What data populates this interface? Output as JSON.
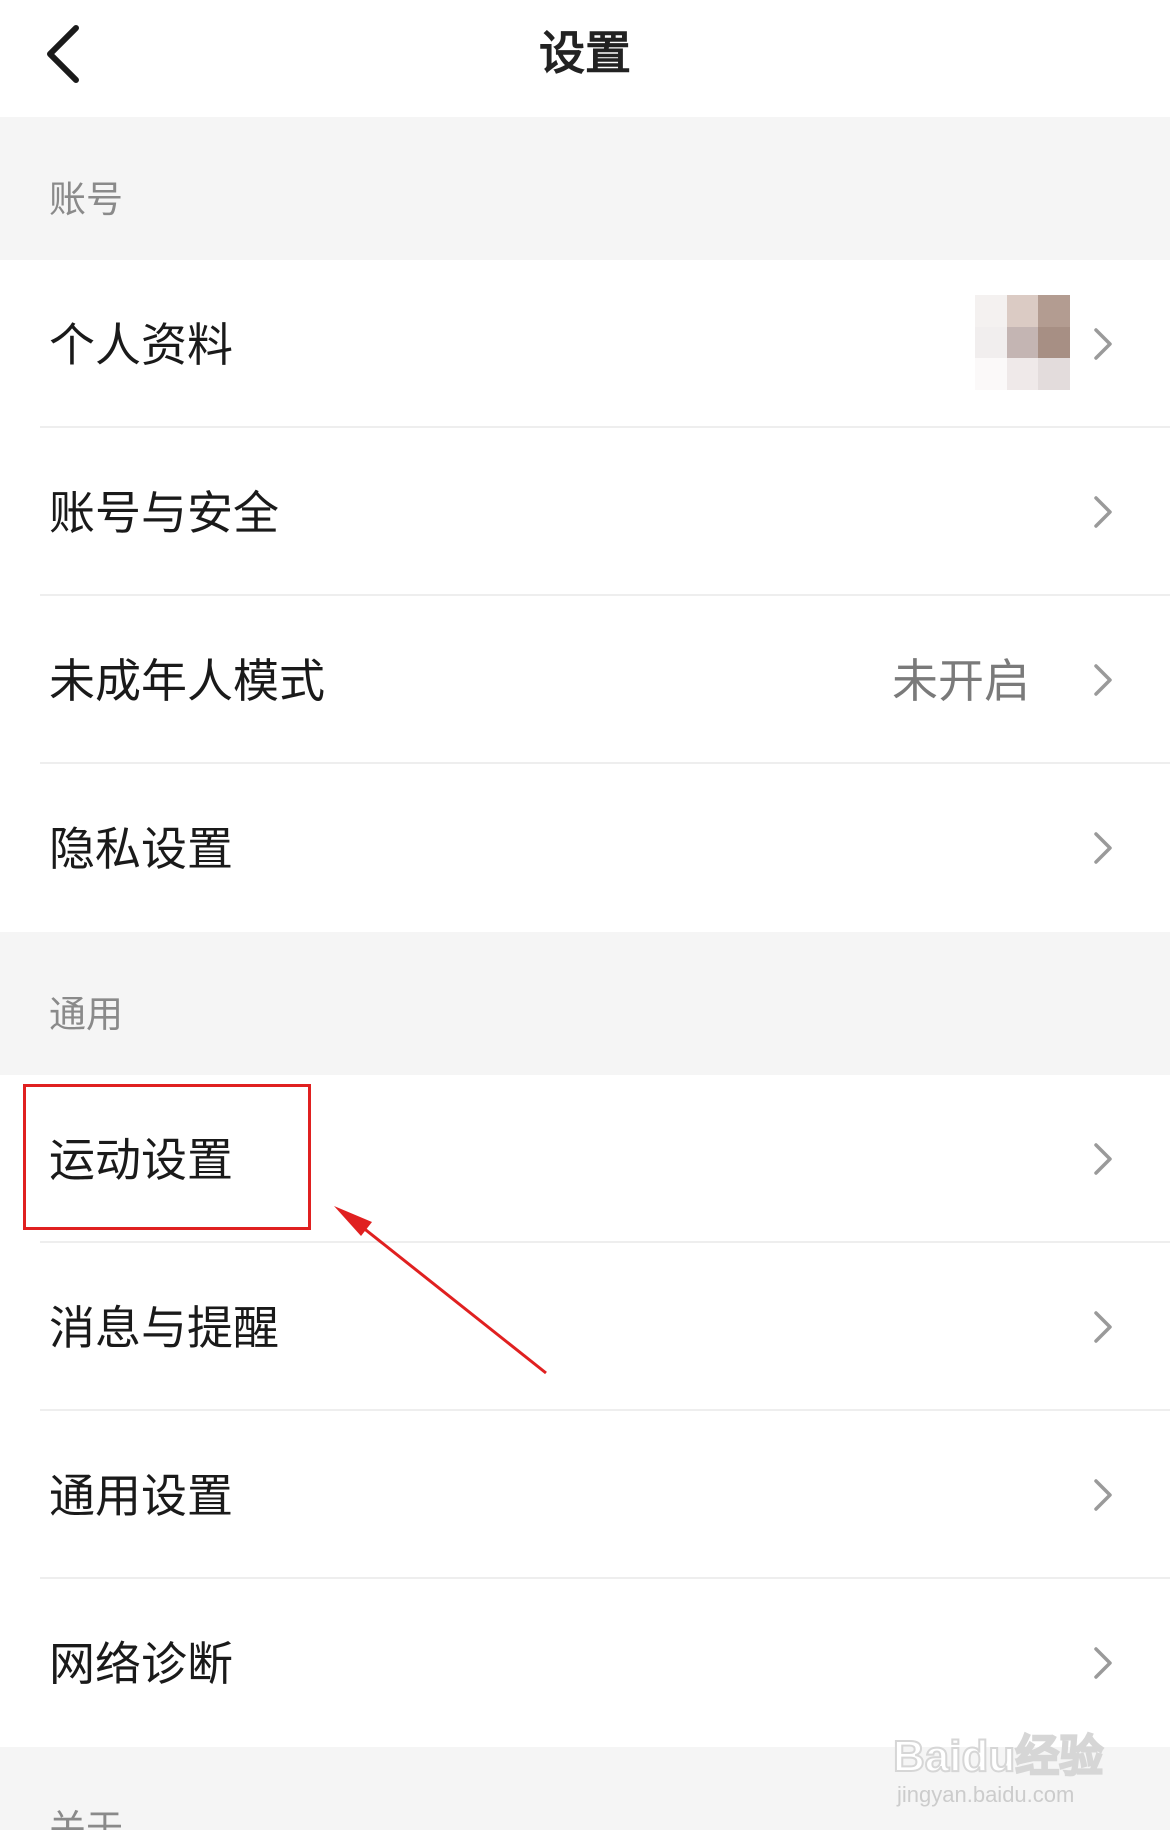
{
  "header": {
    "title": "设置",
    "back_icon": "chevron-left-icon"
  },
  "sections": [
    {
      "title": "账号",
      "items": [
        {
          "label": "个人资料",
          "value": "",
          "has_avatar": true
        },
        {
          "label": "账号与安全",
          "value": ""
        },
        {
          "label": "未成年人模式",
          "value": "未开启"
        },
        {
          "label": "隐私设置",
          "value": ""
        }
      ]
    },
    {
      "title": "通用",
      "items": [
        {
          "label": "运动设置",
          "value": "",
          "highlighted": true
        },
        {
          "label": "消息与提醒",
          "value": ""
        },
        {
          "label": "通用设置",
          "value": ""
        },
        {
          "label": "网络诊断",
          "value": ""
        }
      ]
    },
    {
      "title": "关于",
      "items": []
    }
  ],
  "annotation": {
    "box_color": "#e02020",
    "arrow_color": "#e02020"
  },
  "watermark": {
    "brand": "Baidu经验",
    "url": "jingyan.baidu.com"
  },
  "colors": {
    "section_bg": "#f5f5f5",
    "row_bg": "#ffffff",
    "section_title": "#8a8a8a",
    "label_text": "#1a1a1a",
    "value_text": "#7a7a7a",
    "chevron": "#9a9a9a"
  }
}
